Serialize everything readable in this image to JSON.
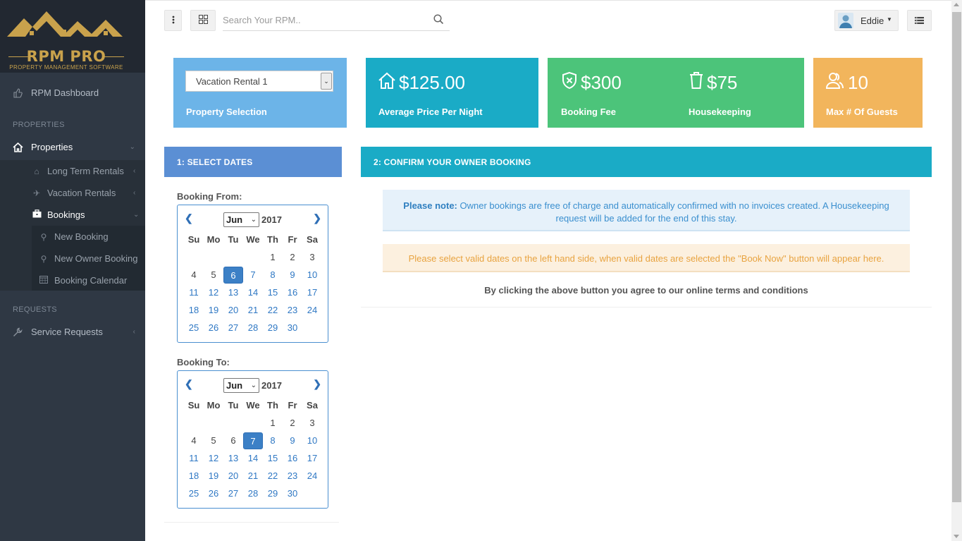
{
  "sidebar": {
    "logo": {
      "brand": "RPM PRO",
      "tagline": "PROPERTY MANAGEMENT SOFTWARE"
    },
    "dashboard": {
      "label": "RPM Dashboard",
      "icon": "thumb-icon"
    },
    "section_properties": "PROPERTIES",
    "properties": {
      "label": "Properties",
      "icon": "home-icon"
    },
    "long_term": {
      "label": "Long Term Rentals",
      "icon": "home-icon"
    },
    "vacation": {
      "label": "Vacation Rentals",
      "icon": "plane-icon"
    },
    "bookings": {
      "label": "Bookings",
      "icon": "briefcase-icon"
    },
    "new_booking": {
      "label": "New Booking",
      "icon": "key-icon"
    },
    "new_owner_booking": {
      "label": "New Owner Booking",
      "icon": "key-icon"
    },
    "booking_calendar": {
      "label": "Booking Calendar",
      "icon": "calendar-icon"
    },
    "section_requests": "REQUESTS",
    "service_requests": {
      "label": "Service Requests",
      "icon": "wrench-icon"
    }
  },
  "topbar": {
    "search_placeholder": "Search Your RPM..",
    "user_name": "Eddie"
  },
  "tiles": {
    "property": {
      "selected": "Vacation Rental 1",
      "caption": "Property Selection",
      "color": "#6cb4e8"
    },
    "price": {
      "value": "$125.00",
      "caption": "Average Price Per Night",
      "color": "#1aabc6"
    },
    "fee": {
      "value": "$300",
      "caption": "Booking Fee",
      "color": "#4cc47a"
    },
    "housekeeping": {
      "value": "$75",
      "caption": "Housekeeping"
    },
    "guests": {
      "value": "10",
      "caption": "Max # Of Guests",
      "color": "#f2b55c"
    }
  },
  "select_dates": {
    "header": "1: SELECT DATES",
    "from_label": "Booking From:",
    "to_label": "Booking To:",
    "from_cal": {
      "month": "Jun",
      "year": "2017",
      "selected": 6
    },
    "to_cal": {
      "month": "Jun",
      "year": "2017",
      "selected": 7
    },
    "weekdays": [
      "Su",
      "Mo",
      "Tu",
      "We",
      "Th",
      "Fr",
      "Sa"
    ]
  },
  "confirm": {
    "header": "2: CONFIRM YOUR OWNER BOOKING",
    "note_bold": "Please note:",
    "note_text": "Owner bookings are free of charge and automatically confirmed with no invoices created. A Housekeeping request will be added for the end of this stay.",
    "warning": "Please select valid dates on the left hand side, when valid dates are selected the \"Book Now\" button will appear here.",
    "terms": "By clicking the above button you agree to our online terms and conditions"
  }
}
